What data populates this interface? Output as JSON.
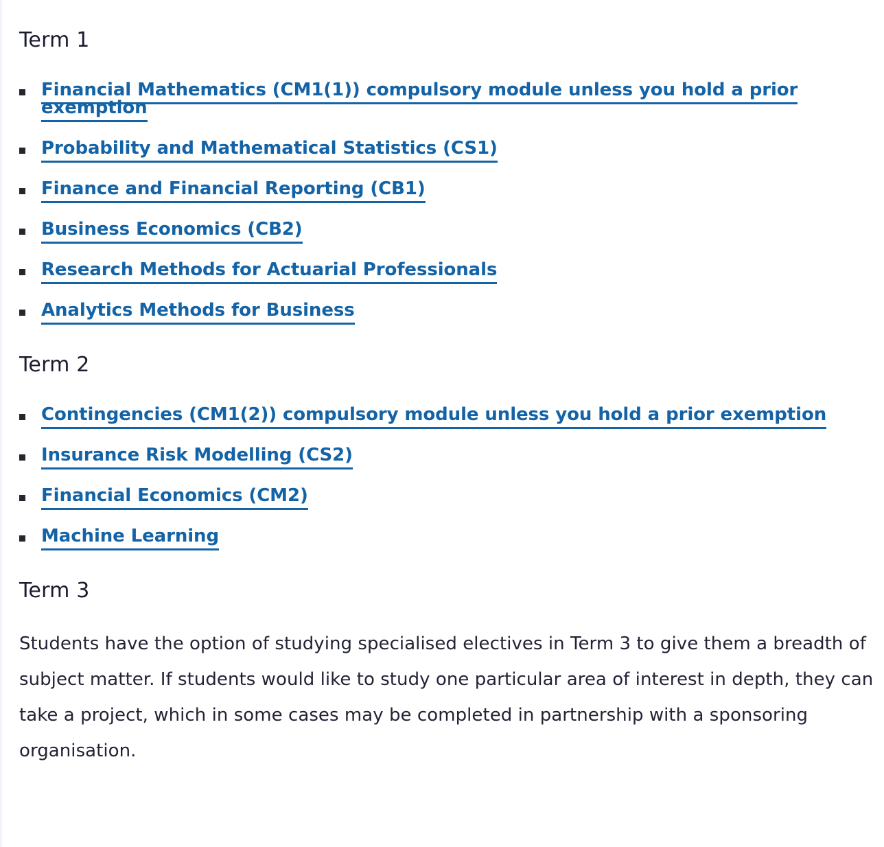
{
  "colors": {
    "link": "#1363a6",
    "heading": "#1b1b2f",
    "body_text": "#232336",
    "bullet": "#26262e",
    "background": "#ffffff"
  },
  "sections": [
    {
      "heading": "Term 1",
      "modules": [
        "Financial Mathematics (CM1(1)) compulsory module unless you hold a prior exemption",
        "Probability and Mathematical Statistics (CS1)",
        "Finance and Financial Reporting (CB1)",
        "Business Economics (CB2)",
        "Research Methods for Actuarial Professionals",
        "Analytics Methods for Business"
      ]
    },
    {
      "heading": "Term 2",
      "modules": [
        "Contingencies (CM1(2)) compulsory module unless you hold a prior exemption",
        "Insurance Risk Modelling (CS2)",
        "Financial Economics (CM2)",
        "Machine Learning"
      ]
    },
    {
      "heading": "Term 3",
      "paragraph": "Students have the option of studying specialised electives in Term 3 to give them a breadth of subject matter. If students would like to study one particular area of interest in depth, they can take a project, which in some cases may be completed in partnership with a sponsoring organisation."
    }
  ]
}
